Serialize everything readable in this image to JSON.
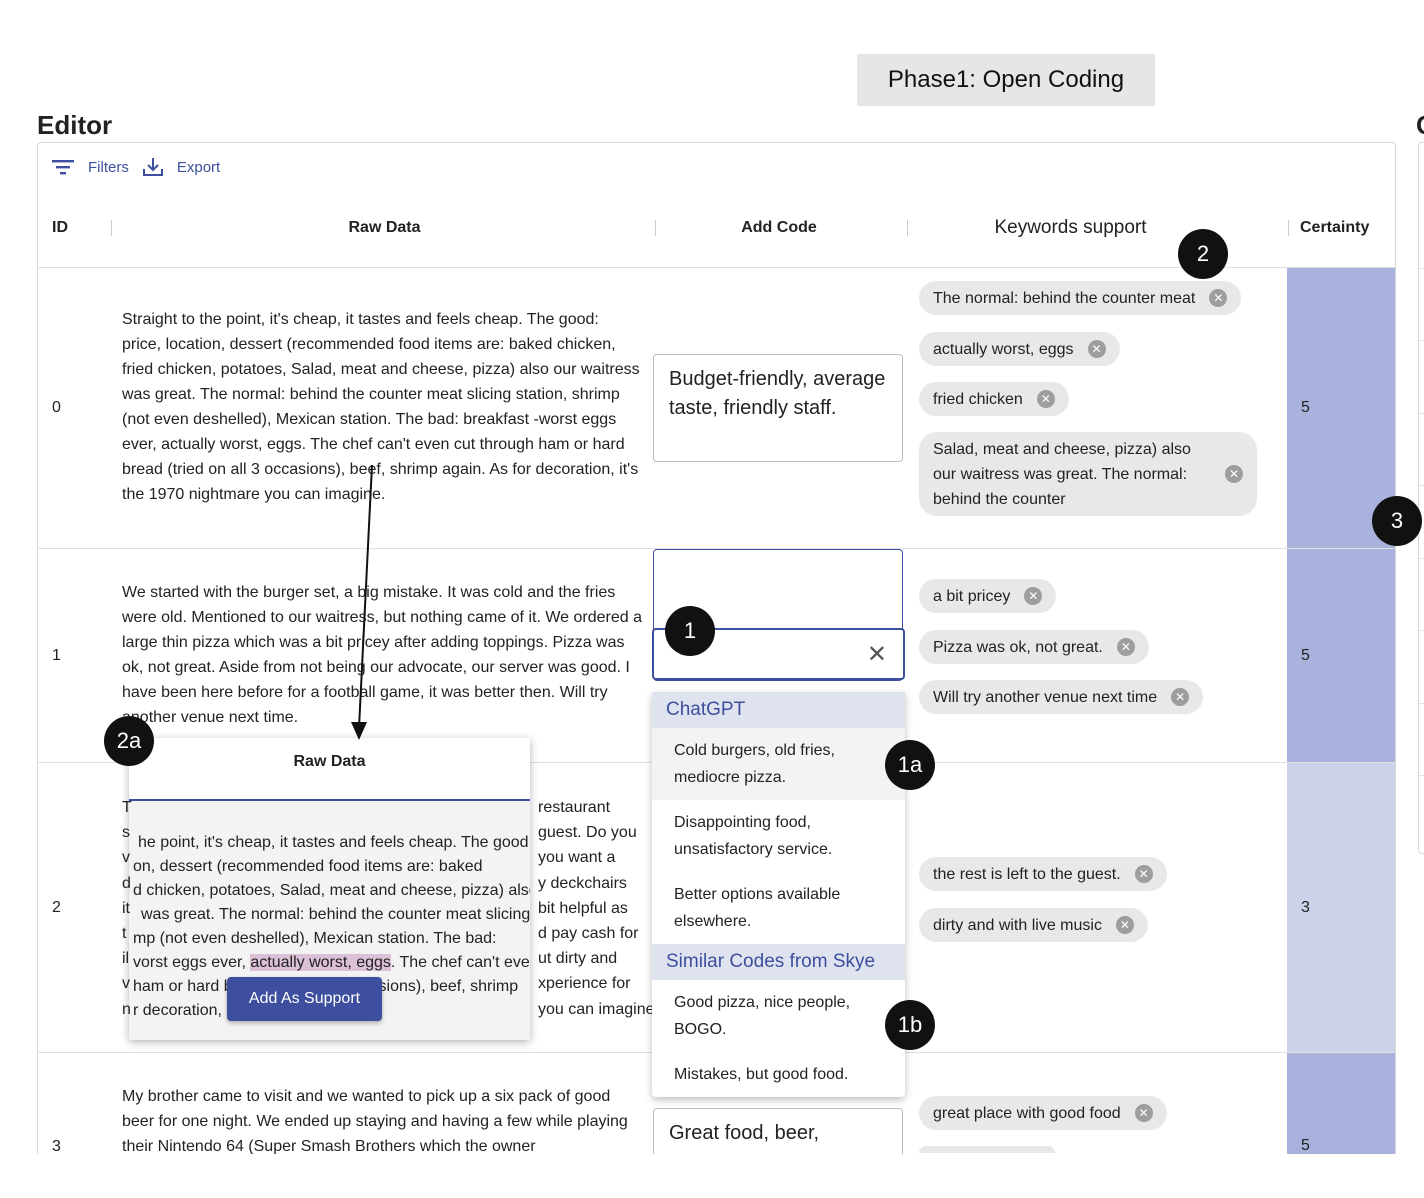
{
  "phase_banner": "Phase1: Open Coding",
  "editor_title": "Editor",
  "clipped_title": "C",
  "toolbar": {
    "filters_label": "Filters",
    "export_label": "Export"
  },
  "columns": {
    "id": "ID",
    "raw_data": "Raw Data",
    "add_code": "Add Code",
    "keywords": "Keywords support",
    "certainty": "Certainty"
  },
  "rows": [
    {
      "id": "0",
      "raw": "Straight to the point, it's cheap, it tastes and feels cheap. The good: price, location, dessert (recommended food items are: baked chicken, fried chicken, potatoes, Salad, meat and cheese, pizza) also our waitress was great. The normal: behind the counter meat slicing station, shrimp (not even deshelled), Mexican station. The bad: breakfast -worst eggs ever, actually worst, eggs. The chef can't even cut through ham or hard bread (tried on all 3 occasions), beef, shrimp again. As for decoration, it's the 1970 nightmare you can imagine.",
      "code": "Budget-friendly, average taste, friendly staff.",
      "keywords": [
        "The normal: behind the counter meat",
        "actually worst, eggs",
        "fried chicken",
        "Salad, meat and cheese, pizza) also our waitress was great. The normal: behind the counter"
      ],
      "certainty": "5",
      "cert_color": "#a8b2dc"
    },
    {
      "id": "1",
      "raw": "We started with the burger set, a big mistake. It was cold and the fries were old. Mentioned to our waitress, but nothing came of it. We ordered a large thin pizza which was a bit pricey after adding toppings. Pizza was ok, not great. Aside from not being our advocate, our server was good. I have been here before for a football game, it was better then. Will try another venue next time.",
      "code": "",
      "keywords": [
        "a bit pricey",
        "Pizza was ok, not great.",
        "Will try another venue next time"
      ],
      "certainty": "5",
      "cert_color": "#a8b2dc"
    },
    {
      "id": "2",
      "raw_right": [
        "restaurant",
        "guest. Do you",
        "you want a",
        "y deckchairs",
        "bit helpful as",
        "d pay cash for",
        "ut dirty and",
        "xperience for",
        "you can imagine."
      ],
      "raw_left": [
        "T",
        "s",
        "v",
        "d",
        "it",
        "t",
        "il",
        "v",
        "n"
      ],
      "keywords": [
        "the rest is left to the guest.",
        "dirty and with live music"
      ],
      "certainty": "3",
      "cert_color": "#ccd2ea"
    },
    {
      "id": "3",
      "raw": "My brother came to visit and we wanted to pick up a six pack of good beer for one night. We ended up staying and having a few while playing their Nintendo 64 (Super Smash Brothers which the owner",
      "code": "Great food, beer,",
      "keywords": [
        "great place with good food"
      ],
      "certainty": "5",
      "cert_color": "#a8b2dc"
    }
  ],
  "dropdown": {
    "clear_icon": "close-icon",
    "groups": [
      {
        "label": "ChatGPT",
        "items": [
          "Cold burgers, old fries, mediocre pizza.",
          "Disappointing food, unsatisfactory service.",
          "Better options available elsewhere."
        ]
      },
      {
        "label": "Similar Codes from Skye",
        "items": [
          "Good pizza, nice people, BOGO.",
          "Mistakes, but good food."
        ]
      }
    ]
  },
  "popup": {
    "title": "Raw Data",
    "lines": [
      "he point, it's cheap, it tastes and feels cheap. The good:",
      "on, dessert (recommended food items are: baked",
      "d chicken, potatoes, Salad, meat and cheese, pizza) also",
      "was great. The normal: behind the counter meat slicing",
      "mp (not even deshelled), Mexican station. The bad:",
      "vorst eggs ever, "
    ],
    "highlight": "actually worst, eggs",
    "line6_after": ". The chef can't even",
    "line7": "ham or hard b",
    "line7_after": "casions), beef, shrimp",
    "line8": "r decoration, i",
    "button": "Add As Support"
  },
  "badges": [
    "1",
    "1a",
    "1b",
    "2",
    "2a",
    "3"
  ]
}
